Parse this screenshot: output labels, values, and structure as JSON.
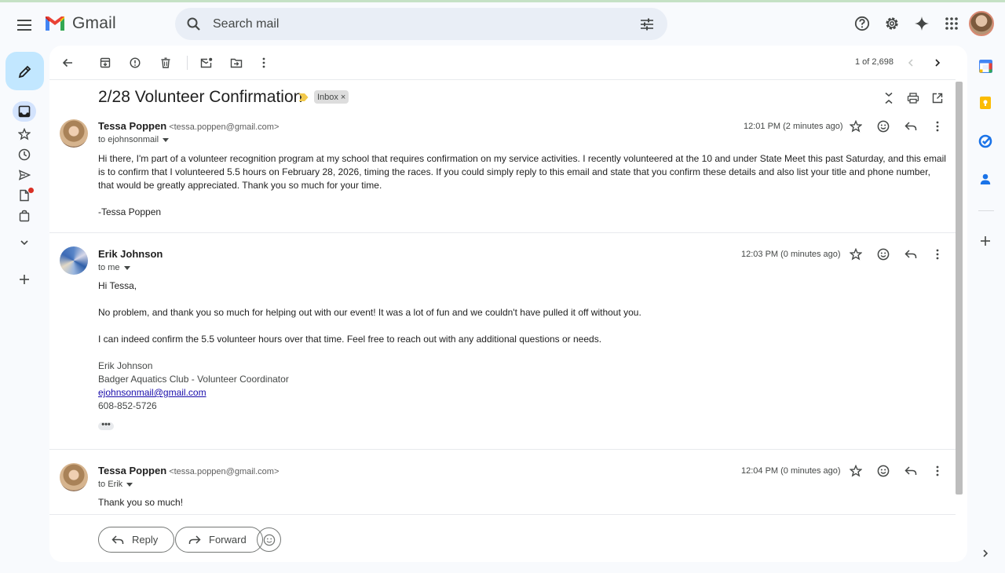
{
  "app": {
    "name": "Gmail"
  },
  "search": {
    "placeholder": "Search mail"
  },
  "toolbar": {
    "page_count": "1 of 2,698"
  },
  "thread": {
    "subject": "2/28 Volunteer Confirmation",
    "label": "Inbox",
    "label_remove": "×"
  },
  "messages": [
    {
      "sender": "Tessa Poppen",
      "email": "<tessa.poppen@gmail.com>",
      "to": "to ejohnsonmail",
      "time": "12:01 PM (2 minutes ago)",
      "body": [
        "Hi there, I'm part of a volunteer recognition program at my school that requires confirmation on my service activities. I recently volunteered at the 10 and under State Meet this past Saturday, and this email is to confirm that I volunteered 5.5 hours on February 28, 2026, timing the races. If you could simply reply to this email and state that you confirm these details and also list your title and phone number, that would be greatly appreciated. Thank you so much for your time.",
        "-Tessa Poppen"
      ]
    },
    {
      "sender": "Erik Johnson",
      "email": "",
      "to": "to me",
      "time": "12:03 PM (0 minutes ago)",
      "body": [
        "Hi Tessa,",
        "No problem, and thank you so much for helping out with our event!  It was a lot of fun and we couldn't have pulled it off without you.",
        "I can indeed confirm the 5.5 volunteer hours over that time.  Feel free to reach out with any additional questions or needs."
      ],
      "signature": {
        "name": "Erik Johnson",
        "title": "Badger Aquatics Club - Volunteer Coordinator",
        "email": "ejohnsonmail@gmail.com",
        "phone": "608-852-5726"
      },
      "trimmed": "•••"
    },
    {
      "sender": "Tessa Poppen",
      "email": "<tessa.poppen@gmail.com>",
      "to": "to Erik",
      "time": "12:04 PM (0 minutes ago)",
      "body": [
        "Thank you so much!"
      ]
    }
  ],
  "actions": {
    "reply": "Reply",
    "forward": "Forward"
  },
  "colors": {
    "compose": "#c2e7ff",
    "active_nav": "#d3e3fd",
    "important": "#f2c94c",
    "link": "#1a0dab"
  }
}
